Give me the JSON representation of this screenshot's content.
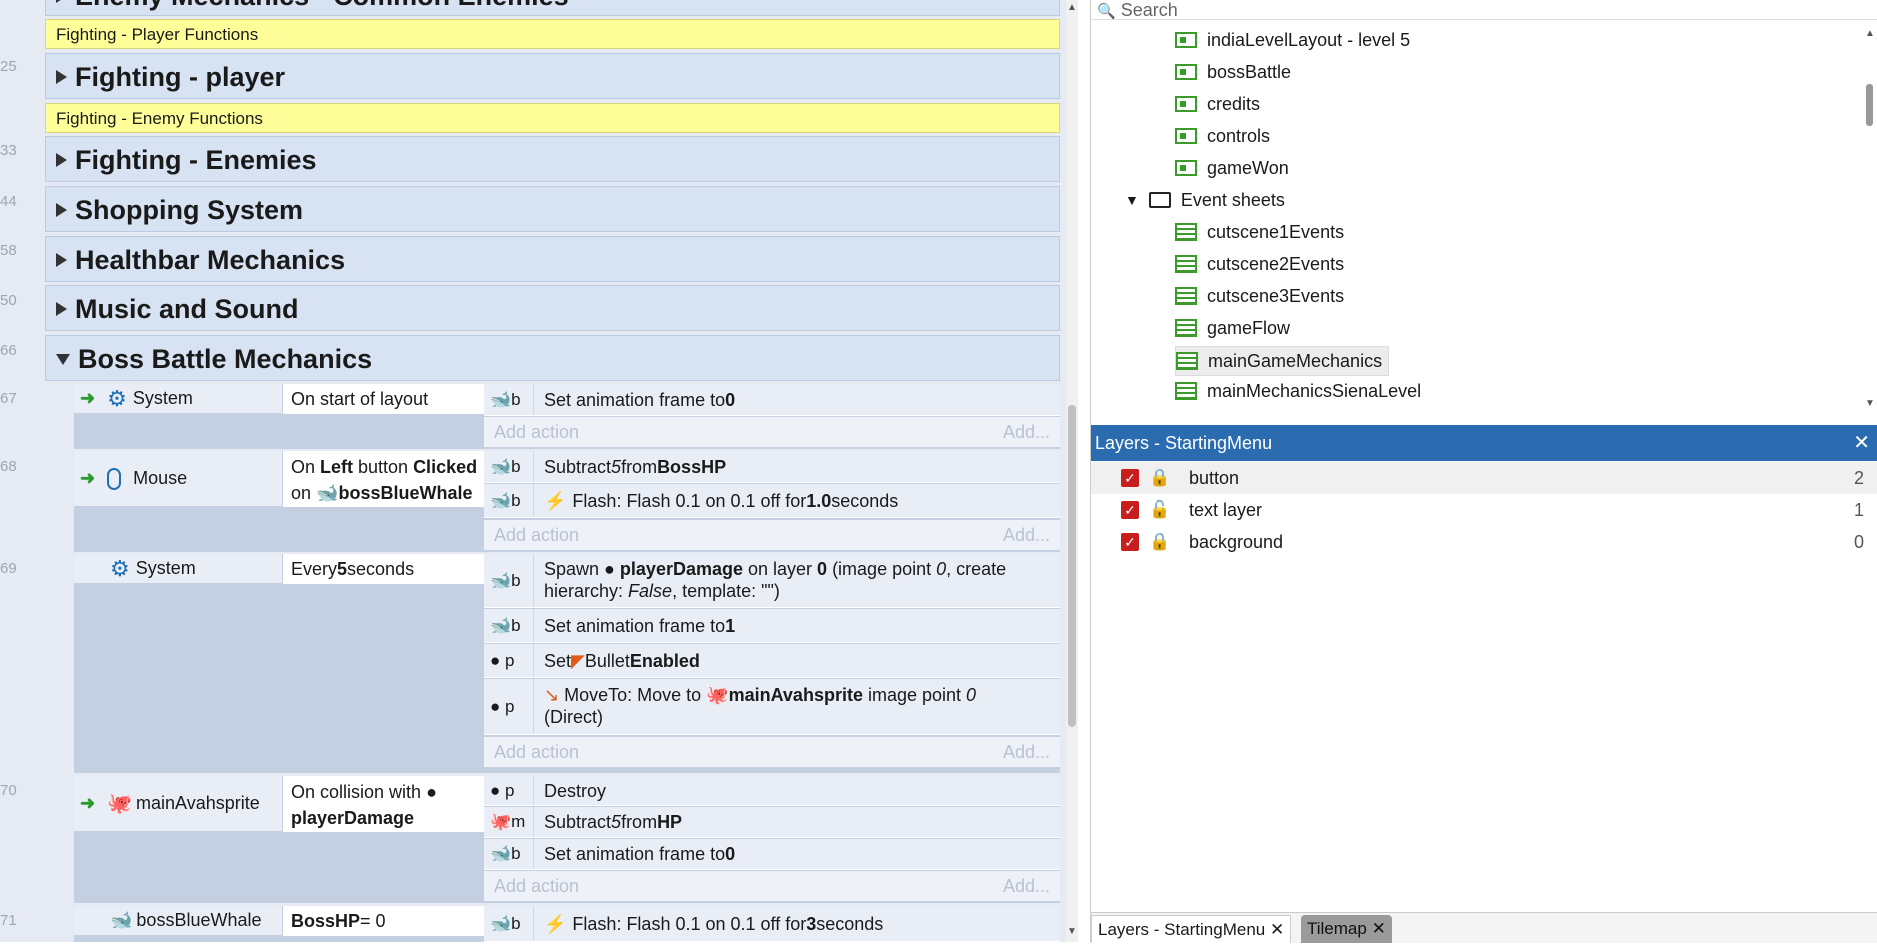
{
  "event_sheet": {
    "top_partial_group": "Enemy Mechanics - Common Enemies",
    "line_numbers": [
      "25",
      "33",
      "44",
      "58",
      "50",
      "66",
      "67",
      "68",
      "69",
      "70",
      "71"
    ],
    "comments": [
      "Fighting - Player Functions",
      "Fighting - Enemy Functions"
    ],
    "groups": [
      "Fighting - player",
      "Fighting - Enemies",
      "Shopping System",
      "Healthbar Mechanics",
      "Music and Sound",
      "Boss Battle Mechanics"
    ],
    "add_action": "Add action",
    "add_more": "Add...",
    "events": [
      {
        "object": "System",
        "object_icon": "gear-icon",
        "condition": "On start of layout",
        "actions": [
          {
            "icon": "whale-icon",
            "obj": "b",
            "text": "Set animation frame to ",
            "bold": "0"
          }
        ]
      },
      {
        "object": "Mouse",
        "object_icon": "mouse-icon",
        "condition_a": "On ",
        "condition_b": "Left",
        "condition_c": " button ",
        "condition_d": "Clicked",
        "condition_e": "on ",
        "condition_f": "bossBlueWhale",
        "actions": [
          {
            "icon": "whale-icon",
            "obj": "b",
            "text": "Subtract ",
            "italic": "5",
            "text2": " from ",
            "bold": "BossHP"
          },
          {
            "icon": "whale-icon",
            "obj": "b",
            "text": "Flash: Flash 0.1 on 0.1 off for ",
            "bold": "1.0",
            "text2": " seconds"
          }
        ]
      },
      {
        "object": "System",
        "object_icon": "gear-icon",
        "condition_a": "Every ",
        "condition_b": "5",
        "condition_c": " seconds",
        "actions": [
          {
            "icon": "whale-icon",
            "obj": "b",
            "l1a": "Spawn ",
            "l1b": "playerDamage",
            "l1c": " on layer ",
            "l1d": "0",
            "l1e": " (image point ",
            "l1f": "0",
            "l1g": ", create",
            "l2a": "hierarchy: ",
            "l2b": "False",
            "l2c": ", template: \"\")"
          },
          {
            "icon": "whale-icon",
            "obj": "b",
            "text": "Set animation frame to ",
            "bold": "1"
          },
          {
            "icon": "dot-icon",
            "obj": "p",
            "text": "Set ",
            "mid": " Bullet ",
            "bold": "Enabled"
          },
          {
            "icon": "dot-icon",
            "obj": "p",
            "l1a": "MoveTo: Move to ",
            "l1b": "mainAvahsprite",
            "l1c": " image point ",
            "l1d": "0",
            "l2a": "(Direct)"
          }
        ]
      },
      {
        "object": "mainAvahsprite",
        "object_icon": "octopus-icon",
        "condition_a": "On collision with ",
        "condition_b": "playerDamage",
        "actions": [
          {
            "icon": "dot-icon",
            "obj": "p",
            "text": "Destroy"
          },
          {
            "icon": "octopus-icon",
            "obj": "m",
            "text": "Subtract ",
            "italic": "5",
            "text2": " from ",
            "bold": "HP"
          },
          {
            "icon": "whale-icon",
            "obj": "b",
            "text": "Set animation frame to ",
            "bold": "0"
          }
        ]
      },
      {
        "object": "bossBlueWhale",
        "object_icon": "whale-icon",
        "condition_a": "BossHP",
        "condition_b": " = 0",
        "actions": [
          {
            "icon": "whale-icon",
            "obj": "b",
            "text": "Flash: Flash 0.1 on 0.1 off for ",
            "bold": "3",
            "text2": " seconds"
          }
        ]
      }
    ]
  },
  "project": {
    "search_placeholder": "Search",
    "layouts": [
      "indiaLevelLayout - level 5",
      "bossBattle",
      "credits",
      "controls",
      "gameWon"
    ],
    "folder": "Event sheets",
    "sheets": [
      "cutscene1Events",
      "cutscene2Events",
      "cutscene3Events",
      "gameFlow",
      "mainGameMechanics",
      "mainMechanicsSienaLevel"
    ]
  },
  "layers": {
    "title": "Layers - StartingMenu",
    "items": [
      {
        "name": "button",
        "index": "2"
      },
      {
        "name": "text layer",
        "index": "1"
      },
      {
        "name": "background",
        "index": "0"
      }
    ],
    "tabs": [
      "Layers - StartingMenu",
      "Tilemap"
    ]
  }
}
